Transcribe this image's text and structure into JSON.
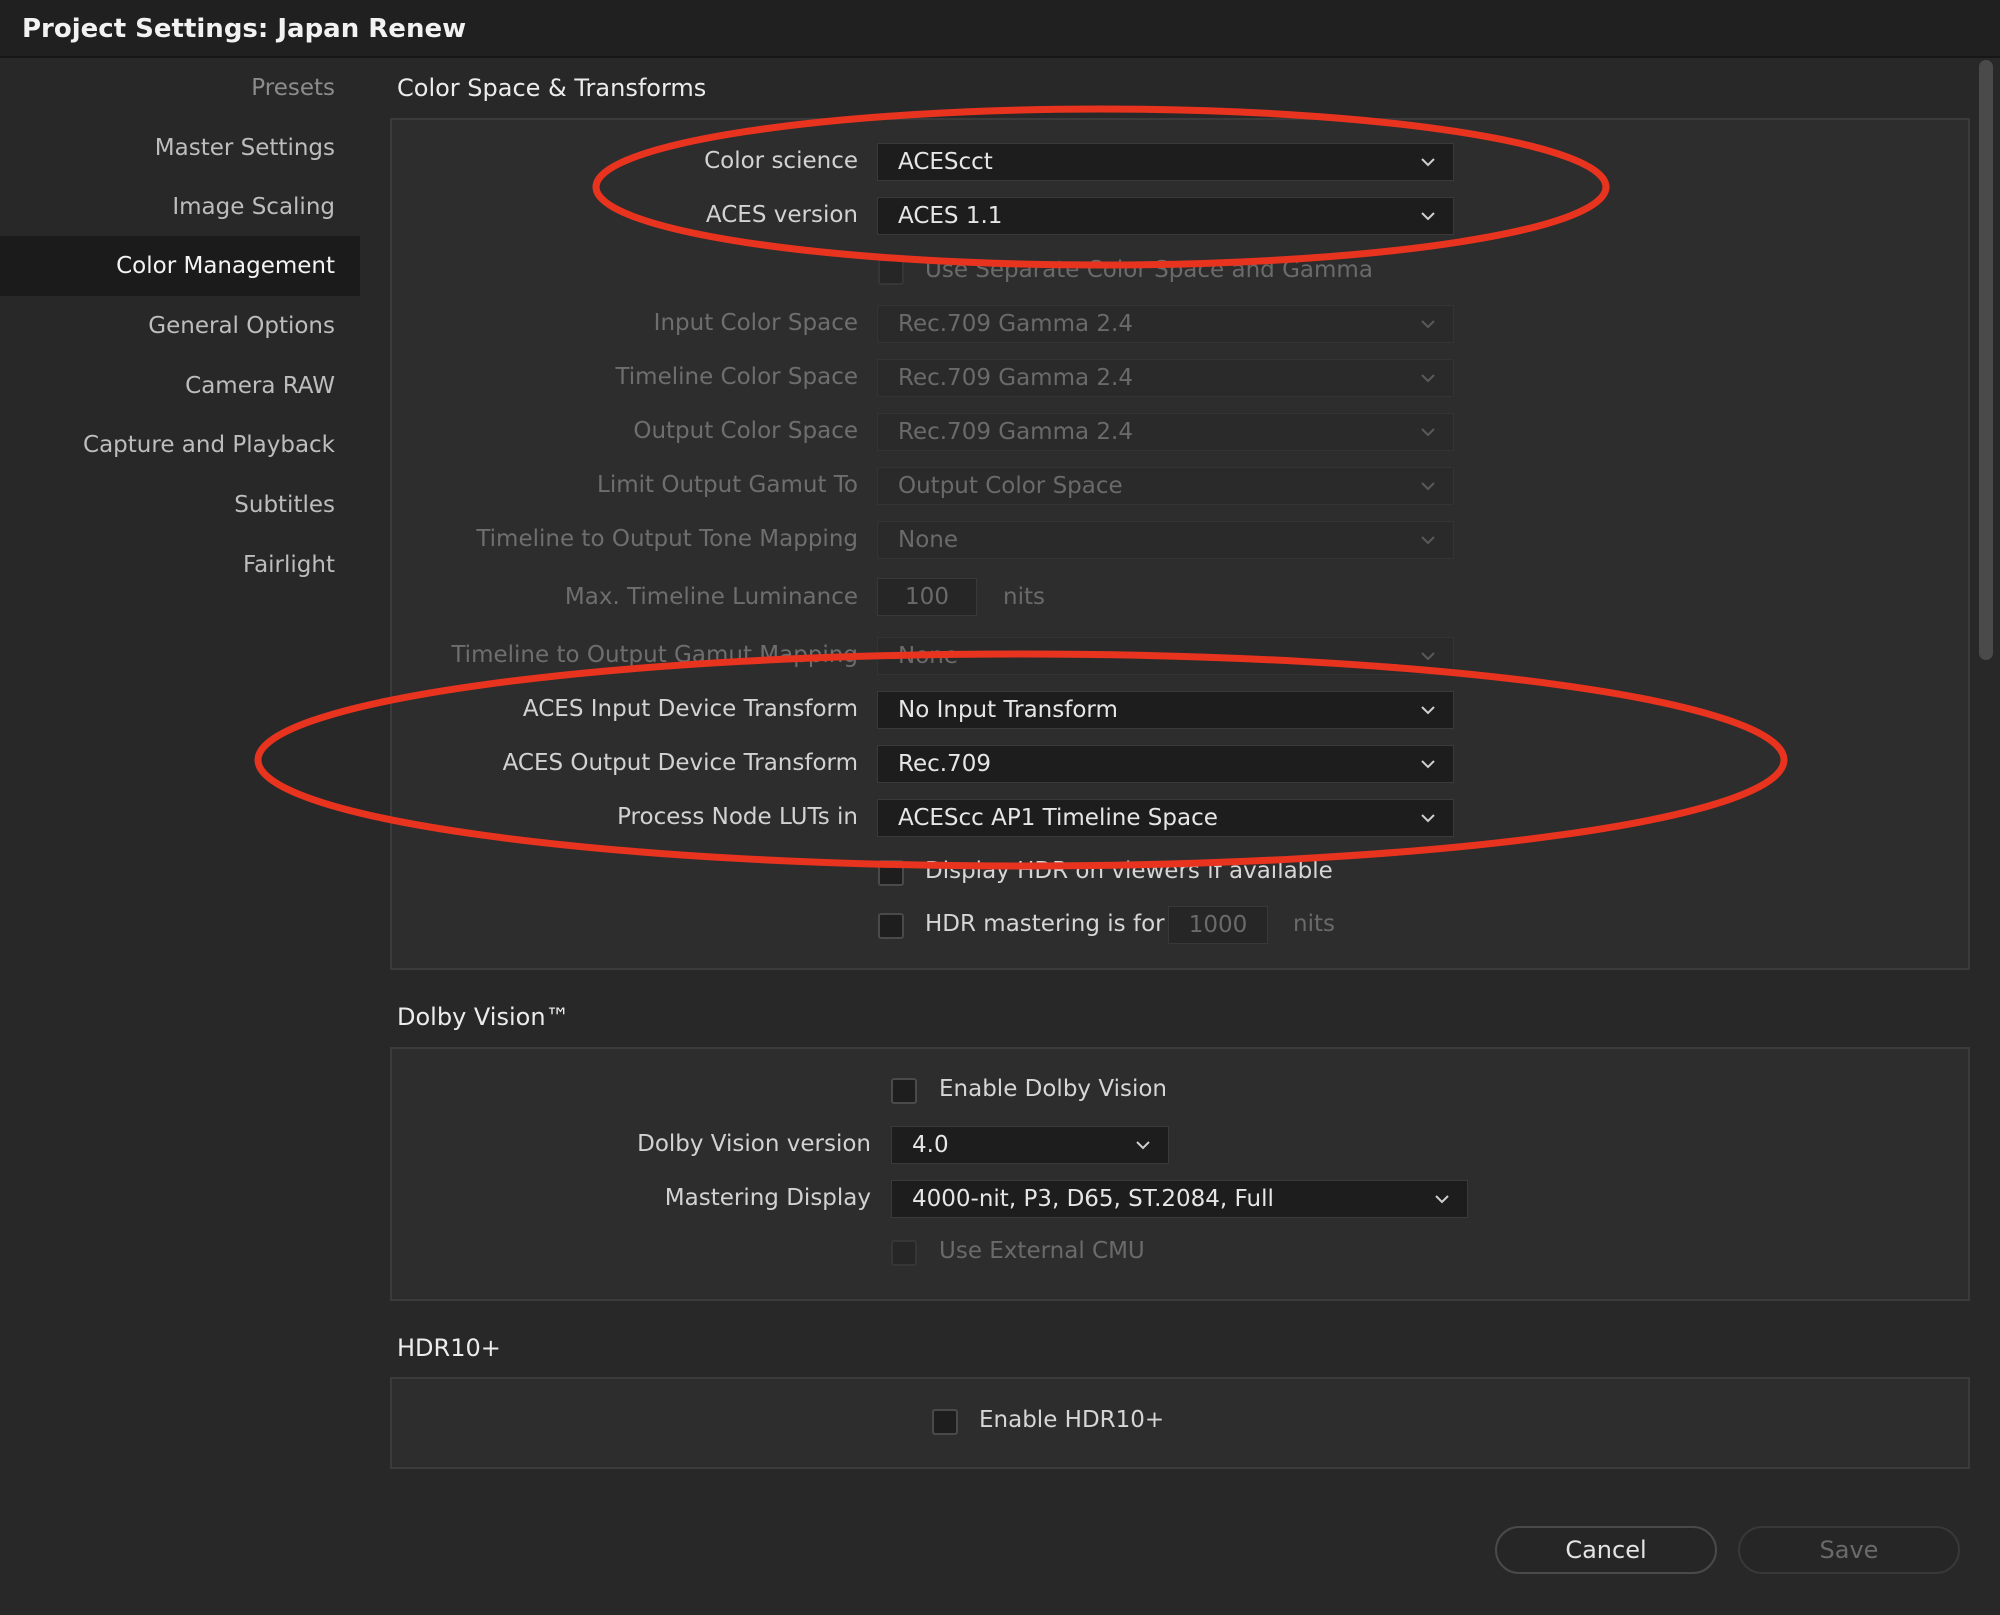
{
  "window": {
    "title": "Project Settings:  Japan Renew"
  },
  "sidebar": {
    "items": [
      {
        "label": "Presets"
      },
      {
        "label": "Master Settings"
      },
      {
        "label": "Image Scaling"
      },
      {
        "label": "Color Management"
      },
      {
        "label": "General Options"
      },
      {
        "label": "Camera RAW"
      },
      {
        "label": "Capture and Playback"
      },
      {
        "label": "Subtitles"
      },
      {
        "label": "Fairlight"
      }
    ],
    "active": "Color Management"
  },
  "color_space": {
    "title": "Color Space & Transforms",
    "color_science_label": "Color science",
    "color_science_value": "ACEScct",
    "aces_version_label": "ACES version",
    "aces_version_value": "ACES 1.1",
    "separate_gamma_label": "Use Separate Color Space and Gamma",
    "input_cs_label": "Input Color Space",
    "input_cs_value": "Rec.709 Gamma 2.4",
    "timeline_cs_label": "Timeline Color Space",
    "timeline_cs_value": "Rec.709 Gamma 2.4",
    "output_cs_label": "Output Color Space",
    "output_cs_value": "Rec.709 Gamma 2.4",
    "limit_gamut_label": "Limit Output Gamut To",
    "limit_gamut_value": "Output Color Space",
    "tone_mapping_label": "Timeline to Output Tone Mapping",
    "tone_mapping_value": "None",
    "max_lum_label": "Max. Timeline Luminance",
    "max_lum_value": "100",
    "max_lum_unit": "nits",
    "gamut_mapping_label": "Timeline to Output Gamut Mapping",
    "gamut_mapping_value": "None",
    "idt_label": "ACES Input Device Transform",
    "idt_value": "No Input Transform",
    "odt_label": "ACES Output Device Transform",
    "odt_value": "Rec.709",
    "luts_label": "Process Node LUTs in",
    "luts_value": "ACEScc AP1 Timeline Space",
    "display_hdr_label": "Display HDR on viewers if available",
    "hdr_mastering_label": "HDR mastering is for",
    "hdr_mastering_value": "1000",
    "hdr_mastering_unit": "nits"
  },
  "dolby": {
    "title": "Dolby Vision™",
    "enable_label": "Enable Dolby Vision",
    "version_label": "Dolby Vision version",
    "version_value": "4.0",
    "mastering_label": "Mastering Display",
    "mastering_value": "4000-nit, P3, D65, ST.2084, Full",
    "external_cmu_label": "Use External CMU"
  },
  "hdr10": {
    "title": "HDR10+",
    "enable_label": "Enable HDR10+"
  },
  "footer": {
    "cancel_label": "Cancel",
    "save_label": "Save"
  },
  "annotations": {
    "ellipse_color": "#e8331f"
  }
}
